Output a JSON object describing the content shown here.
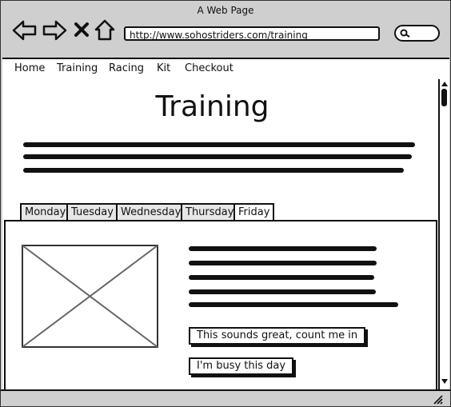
{
  "window": {
    "title": "A Web Page"
  },
  "browser": {
    "url": "http://www.sohostriders.com/training"
  },
  "nav": {
    "items": [
      {
        "label": "Home"
      },
      {
        "label": "Training"
      },
      {
        "label": "Racing"
      },
      {
        "label": "Kit"
      },
      {
        "label": "Checkout"
      }
    ]
  },
  "page": {
    "title": "Training"
  },
  "tabs": [
    {
      "label": "Monday"
    },
    {
      "label": "Tuesday"
    },
    {
      "label": "Wednesday"
    },
    {
      "label": "Thursday"
    },
    {
      "label": "Friday"
    }
  ],
  "panel": {
    "image_alt": "image-placeholder",
    "buttons": {
      "primary": "This sounds great, count me in",
      "secondary": "I'm busy this day"
    }
  },
  "colors": {
    "chrome": "#cfcfcf",
    "ink": "#111111",
    "inactive_tab": "#e6e6e6"
  }
}
